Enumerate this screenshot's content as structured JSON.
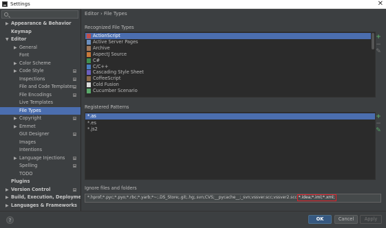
{
  "window": {
    "title": "Settings",
    "close_glyph": "✕"
  },
  "sidebar": {
    "items": [
      {
        "label": "Appearance & Behavior",
        "bold": true,
        "arrow": "▶",
        "level": 0
      },
      {
        "label": "Keymap",
        "bold": true,
        "arrow": "",
        "level": 0
      },
      {
        "label": "Editor",
        "bold": true,
        "arrow": "▼",
        "level": 0
      },
      {
        "label": "General",
        "bold": false,
        "arrow": "▶",
        "level": 1
      },
      {
        "label": "Font",
        "bold": false,
        "arrow": "",
        "level": 1
      },
      {
        "label": "Color Scheme",
        "bold": false,
        "arrow": "▶",
        "level": 1
      },
      {
        "label": "Code Style",
        "bold": false,
        "arrow": "▶",
        "level": 1,
        "project": true
      },
      {
        "label": "Inspections",
        "bold": false,
        "arrow": "",
        "level": 1,
        "project": true
      },
      {
        "label": "File and Code Templates",
        "bold": false,
        "arrow": "",
        "level": 1,
        "project": true
      },
      {
        "label": "File Encodings",
        "bold": false,
        "arrow": "",
        "level": 1,
        "project": true
      },
      {
        "label": "Live Templates",
        "bold": false,
        "arrow": "",
        "level": 1
      },
      {
        "label": "File Types",
        "bold": false,
        "arrow": "",
        "level": 1,
        "selected": true
      },
      {
        "label": "Copyright",
        "bold": false,
        "arrow": "▶",
        "level": 1,
        "project": true
      },
      {
        "label": "Emmet",
        "bold": false,
        "arrow": "▶",
        "level": 1
      },
      {
        "label": "GUI Designer",
        "bold": false,
        "arrow": "",
        "level": 1,
        "project": true
      },
      {
        "label": "Images",
        "bold": false,
        "arrow": "",
        "level": 1
      },
      {
        "label": "Intentions",
        "bold": false,
        "arrow": "",
        "level": 1
      },
      {
        "label": "Language Injections",
        "bold": false,
        "arrow": "▶",
        "level": 1,
        "project": true
      },
      {
        "label": "Spelling",
        "bold": false,
        "arrow": "",
        "level": 1,
        "project": true
      },
      {
        "label": "TODO",
        "bold": false,
        "arrow": "",
        "level": 1
      },
      {
        "label": "Plugins",
        "bold": true,
        "arrow": "",
        "level": 0
      },
      {
        "label": "Version Control",
        "bold": true,
        "arrow": "▶",
        "level": 0,
        "project": true
      },
      {
        "label": "Build, Execution, Deployment",
        "bold": true,
        "arrow": "▶",
        "level": 0
      },
      {
        "label": "Languages & Frameworks",
        "bold": true,
        "arrow": "▶",
        "level": 0
      }
    ]
  },
  "main": {
    "breadcrumb": "Editor › File Types",
    "recognized": {
      "label": "Recognized File Types",
      "items": [
        {
          "label": "ActionScript",
          "icon": "actionscript-icon",
          "color": "#c0504d",
          "selected": true
        },
        {
          "label": "Active Server Pages",
          "icon": "asp-icon",
          "color": "#6a8fbf"
        },
        {
          "label": "Archive",
          "icon": "archive-icon",
          "color": "#a0785a"
        },
        {
          "label": "AspectJ Source",
          "icon": "aspectj-icon",
          "color": "#c9793a"
        },
        {
          "label": "C#",
          "icon": "csharp-icon",
          "color": "#3f8f4f"
        },
        {
          "label": "C/C++",
          "icon": "cpp-icon",
          "color": "#4a7fc0"
        },
        {
          "label": "Cascading Style Sheet",
          "icon": "css-icon",
          "color": "#6a5fbf"
        },
        {
          "label": "CoffeeScript",
          "icon": "coffeescript-icon",
          "color": "#8a6a4a"
        },
        {
          "label": "Cold Fusion",
          "icon": "coldfusion-icon",
          "color": "#dddddd"
        },
        {
          "label": "Cucumber Scenario",
          "icon": "cucumber-icon",
          "color": "#59a869"
        }
      ]
    },
    "patterns": {
      "label": "Registered Patterns",
      "items": [
        {
          "label": "*.as",
          "selected": true
        },
        {
          "label": "*.es",
          "selected": false
        },
        {
          "label": "*.js2",
          "selected": false
        }
      ]
    },
    "ignore": {
      "label": "Ignore files and folders",
      "value_before": "*.hprof;*.pyc;*.pyo;*.rbc;*.yarb;*~;.DS_Store;.git;.hg;.svn;CVS;__pycache__;_svn;vssver.scc;vssver2.scc;",
      "value_highlight": "*.idea;*.iml;*.xml;"
    },
    "tools": {
      "add": "+",
      "remove": "−",
      "edit": "✎"
    }
  },
  "footer": {
    "help_label": "?",
    "ok_label": "OK",
    "cancel_label": "Cancel",
    "apply_label": "Apply"
  },
  "colors": {
    "background": "#3c3f41",
    "panel": "#2b2b2b",
    "selection": "#4b6eaf",
    "accent_green": "#59a869",
    "highlight_red": "#e0202a"
  }
}
